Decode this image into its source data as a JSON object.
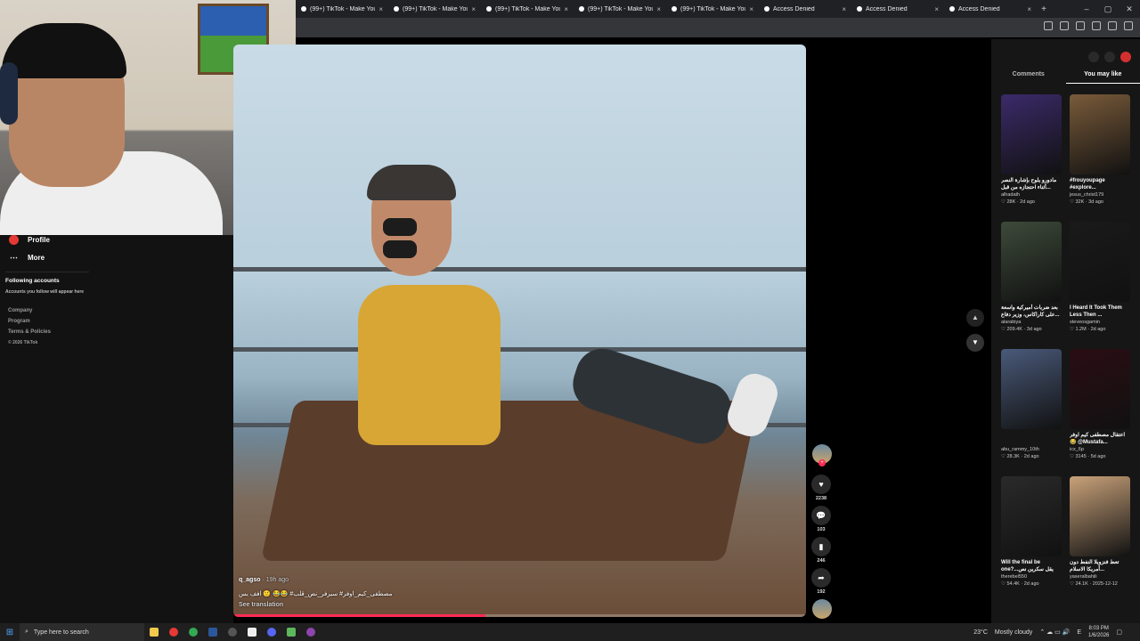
{
  "browser": {
    "tabs": [
      {
        "title": "(99+) TikTok - Make Your Day",
        "icon": "tiktok-icon"
      },
      {
        "title": "(99+) TikTok - Make Your Day",
        "icon": "tiktok-icon"
      },
      {
        "title": "(99+) TikTok - Make Your Day",
        "icon": "tiktok-icon"
      },
      {
        "title": "(99+) TikTok - Make Your Day",
        "icon": "tiktok-icon"
      },
      {
        "title": "(99+) TikTok - Make Your Day",
        "icon": "tiktok-icon"
      },
      {
        "title": "Access Denied",
        "icon": "tiktok-icon"
      },
      {
        "title": "Access Denied",
        "icon": "tiktok-icon"
      },
      {
        "title": "Access Denied",
        "icon": "tiktok-icon"
      }
    ],
    "new_tab": "+",
    "close_glyph": "×"
  },
  "sidebar": {
    "profile_label": "Profile",
    "more_label": "More",
    "following_heading": "Following accounts",
    "following_sub": "Accounts you follow will appear here",
    "footer": [
      "Company",
      "Program",
      "Terms & Policies"
    ],
    "copyright": "© 2026 TikTok"
  },
  "video": {
    "author": "q_agso",
    "time_ago": "19h ago",
    "caption": "مصطفى_كيم_اوفر# سيرفر_نص_قلب# 😂😂 🙂 افف بس",
    "see_translation": "See translation",
    "progress": 0.44
  },
  "actions": {
    "likes": "2238",
    "comments": "103",
    "saves": "246",
    "shares": "192"
  },
  "right_panel": {
    "tabs": [
      {
        "label": "Comments",
        "active": false
      },
      {
        "label": "You may like",
        "active": true
      }
    ],
    "cards": [
      {
        "title": "مادورو يلوح بإشارة النصر ...أثناء احتجازه من قبل",
        "user": "alhadath",
        "likes": "28K",
        "age": "2d ago",
        "color": "#3b2a6a"
      },
      {
        "title": "#frouyoupage #explore...",
        "user": "jesus_christ179",
        "likes": "32K",
        "age": "3d ago",
        "color": "#7a5b3a"
      },
      {
        "title": "بعد ضربات أميركية واسعة ...على كاراكاس، وزير دفاع",
        "user": "alarabiya",
        "likes": "209.4K",
        "age": "3d ago",
        "color": "#3d4a3a"
      },
      {
        "title": "I Heard It Took Them Less Then ...",
        "user": "steveosgamin",
        "likes": "1.2M",
        "age": "2d ago",
        "color": "#1a1a1a"
      },
      {
        "title": "",
        "user": "abu_rammy_10th",
        "likes": "28.3K",
        "age": "2d ago",
        "color": "#4a5a7a"
      },
      {
        "title": "اعتقال مصطفى كيم اوفر 😂 @Mustafa...",
        "user": "icx_6p",
        "likes": "3145",
        "age": "5d ago",
        "color": "#2a0d14"
      },
      {
        "title": "Will the final be one?...يقل سكرين نص",
        "user": "therebel550",
        "likes": "54.4K",
        "age": "2d ago",
        "color": "#2a2a2a"
      },
      {
        "title": "تعط فنزويلا النفط دون ...أمريكا الاسلام",
        "user": "yaseralbahili",
        "likes": "24.1K",
        "age": "2025-12-12",
        "color": "#c9a27a"
      }
    ]
  },
  "taskbar": {
    "search_placeholder": "Type here to search",
    "weather": "23°C",
    "weather_desc": "Mostly cloudy",
    "time": "8:03 PM",
    "date": "1/6/2026",
    "lang": "E"
  },
  "colors": {
    "accent": "#fe2c55",
    "background": "#000000",
    "panel": "#161616"
  }
}
